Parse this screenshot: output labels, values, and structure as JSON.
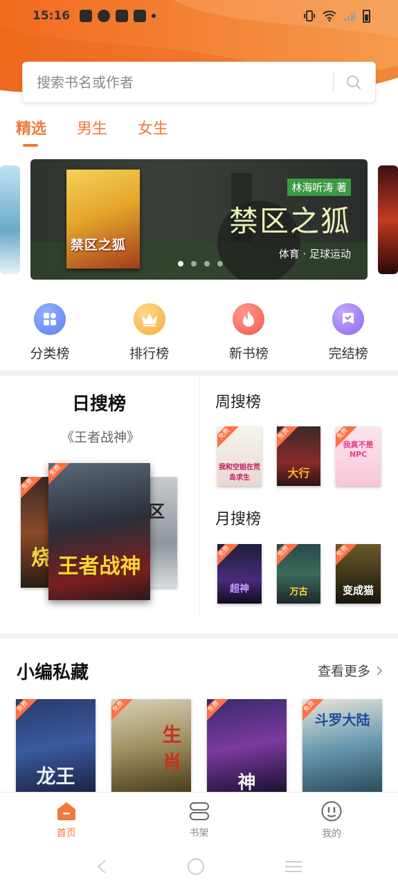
{
  "status": {
    "time": "15:16"
  },
  "search": {
    "placeholder": "搜索书名或作者"
  },
  "tabs": [
    {
      "label": "精选",
      "active": true
    },
    {
      "label": "男生",
      "active": false
    },
    {
      "label": "女生",
      "active": false
    }
  ],
  "banner": {
    "book_cover_title": "禁区之狐",
    "author_tag": "林海听涛 著",
    "title": "禁区之狐",
    "subtitle": "体育 · 足球运动",
    "dots": 4,
    "active_dot": 1
  },
  "quick_nav": [
    {
      "label": "分类榜",
      "icon": "category-icon",
      "color": "#6a8cf0"
    },
    {
      "label": "排行榜",
      "icon": "crown-icon",
      "color": "#f7b94a"
    },
    {
      "label": "新书榜",
      "icon": "flame-icon",
      "color": "#f46a5e"
    },
    {
      "label": "完结榜",
      "icon": "check-badge-icon",
      "color": "#9b7cf0"
    }
  ],
  "rankings": {
    "day_title": "日搜榜",
    "day_subtitle": "《王者战神》",
    "day_main_cover": "王者战神",
    "day_left_cover": "烧",
    "day_right_cover": "区",
    "week_title": "周搜榜",
    "week_books": [
      "我和空姐在荒岛求生",
      "大行",
      "我真不是NPC"
    ],
    "month_title": "月搜榜",
    "month_books": [
      "超神",
      "万古",
      "变成猫"
    ]
  },
  "picks": {
    "title": "小编私藏",
    "more_label": "查看更多",
    "books": [
      "龙王",
      "生肖",
      "神",
      "斗罗大陆"
    ]
  },
  "free_tag": "免费",
  "bottom_nav": [
    {
      "label": "首页",
      "icon": "home-icon",
      "active": true
    },
    {
      "label": "书架",
      "icon": "bookshelf-icon",
      "active": false
    },
    {
      "label": "我的",
      "icon": "profile-icon",
      "active": false
    }
  ],
  "colors": {
    "accent": "#f07a3c",
    "header": "#f0782f"
  }
}
